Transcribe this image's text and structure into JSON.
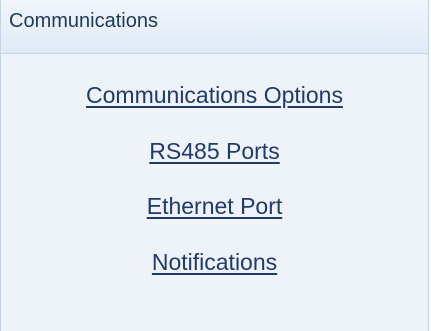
{
  "panel": {
    "title": "Communications",
    "links": [
      {
        "label": "Communications Options"
      },
      {
        "label": "RS485 Ports"
      },
      {
        "label": "Ethernet Port"
      },
      {
        "label": "Notifications"
      }
    ]
  }
}
